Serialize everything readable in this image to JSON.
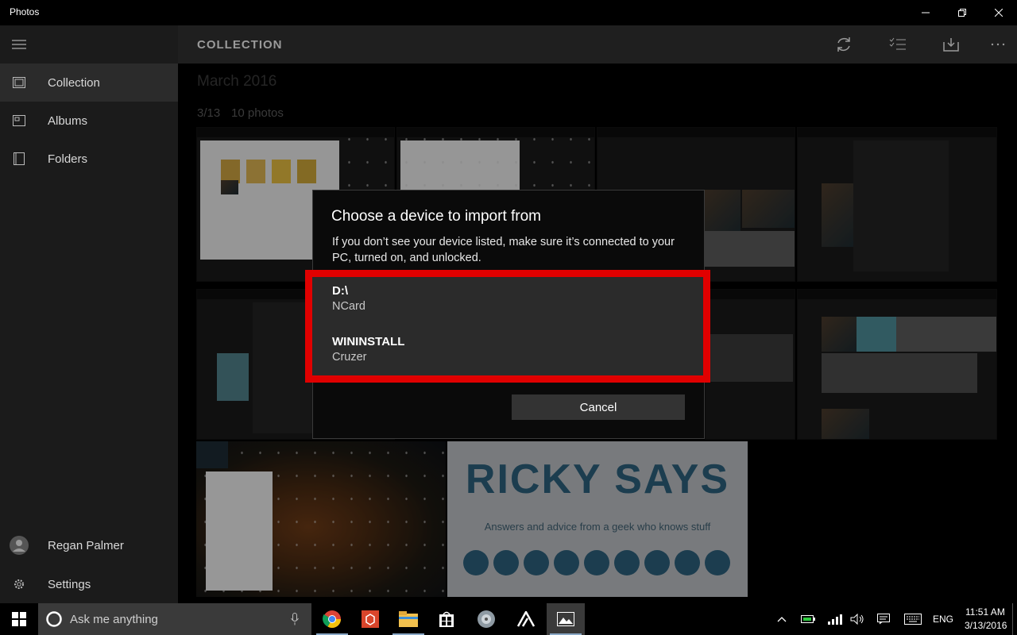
{
  "window": {
    "title": "Photos"
  },
  "sidebar": {
    "items": [
      {
        "label": "Collection",
        "icon": "collection-icon"
      },
      {
        "label": "Albums",
        "icon": "albums-icon"
      },
      {
        "label": "Folders",
        "icon": "folders-icon"
      }
    ],
    "user": "Regan Palmer",
    "settings_label": "Settings"
  },
  "header": {
    "title": "COLLECTION"
  },
  "collection": {
    "month": "March 2016",
    "date": "3/13",
    "count": "10 photos"
  },
  "thumbnails": {
    "ricky_title": "RICKY SAYS",
    "ricky_subtitle": "Answers and advice from a geek who knows stuff"
  },
  "dialog": {
    "title": "Choose a device to import from",
    "message": "If you don’t see your device listed, make sure it’s connected to your PC, turned on, and unlocked.",
    "devices": [
      {
        "name": "D:\\",
        "description": "NCard"
      },
      {
        "name": "WININSTALL",
        "description": "Cruzer"
      }
    ],
    "highlight_color": "#e00000",
    "cancel_label": "Cancel"
  },
  "taskbar": {
    "search_placeholder": "Ask me anything",
    "language": "ENG",
    "time": "11:51 AM",
    "date": "3/13/2016"
  }
}
